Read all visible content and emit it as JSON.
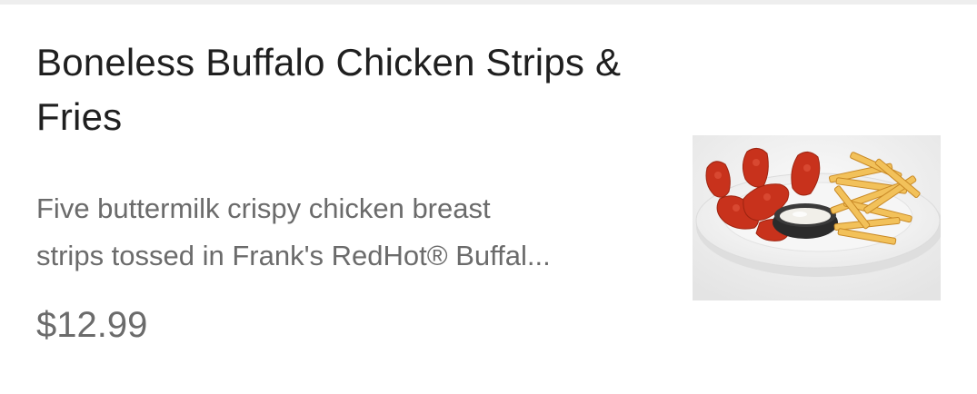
{
  "menu_item": {
    "title": "Boneless Buffalo Chicken Strips & Fries",
    "description": "Five buttermilk crispy chicken breast\nstrips  tossed in Frank's RedHot® Buffal...",
    "price": "$12.99",
    "image_alt": "Boneless Buffalo Chicken Strips & Fries"
  },
  "colors": {
    "title": "#1f1f1f",
    "secondary_text": "#6b6b6b",
    "divider": "#eeeeee"
  }
}
